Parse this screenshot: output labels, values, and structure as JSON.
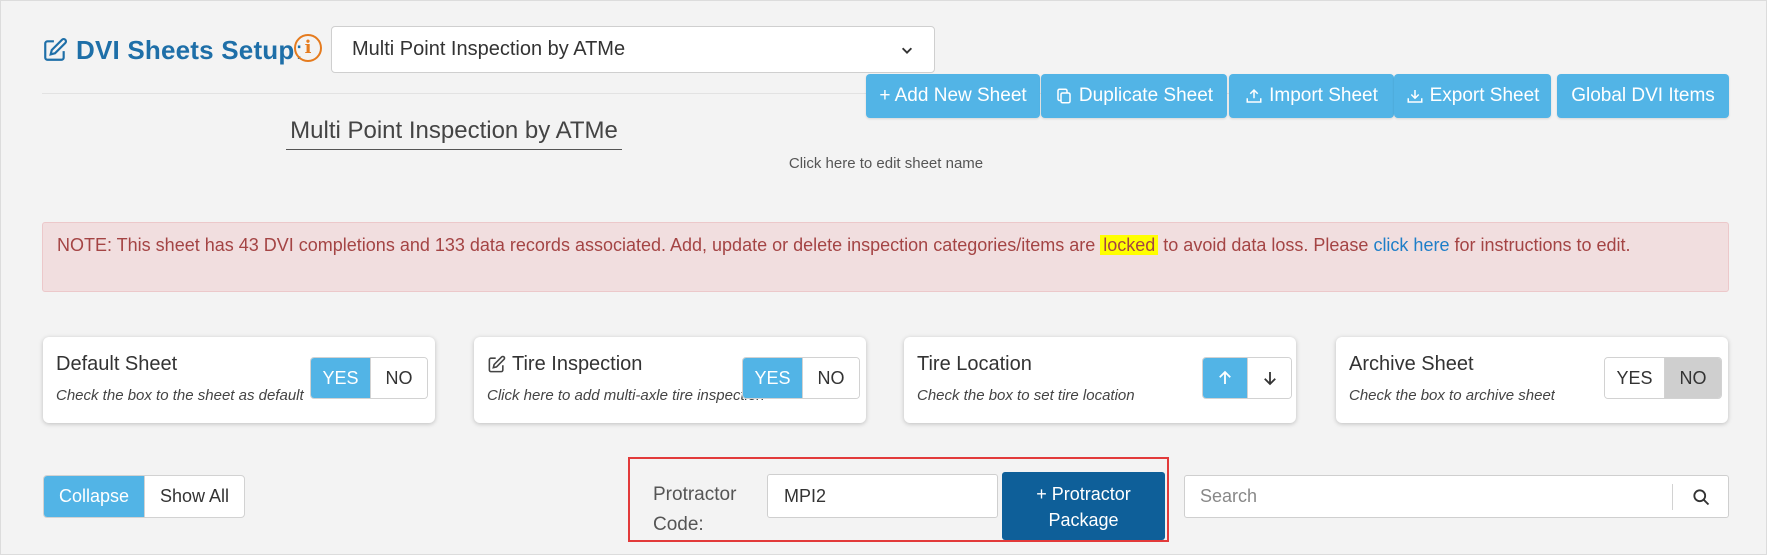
{
  "header": {
    "title": "DVI Sheets Setup",
    "colon": ":",
    "info_icon_glyph": "i",
    "selected_sheet": "Multi Point Inspection by ATMe"
  },
  "toolbar": {
    "add_new_sheet": "+ Add New Sheet",
    "duplicate_sheet": "Duplicate Sheet",
    "import_sheet": "Import Sheet",
    "export_sheet": "Export Sheet",
    "global_dvi_items": "Global DVI Items"
  },
  "sheet": {
    "name": "Multi Point Inspection by ATMe",
    "edit_hint": "Click here to edit sheet name"
  },
  "alert": {
    "text_before": "NOTE: This sheet has 43 DVI completions and 133 data records associated. Add, update or delete inspection categories/items are ",
    "highlight": "locked",
    "text_middle": " to avoid data loss. Please ",
    "link": "click here",
    "text_after": " for instructions to edit."
  },
  "cards": {
    "default_sheet": {
      "title": "Default Sheet",
      "subtitle": "Check the box to the sheet as default",
      "yes": "YES",
      "no": "NO",
      "selected": "YES"
    },
    "tire_inspection": {
      "title": "Tire Inspection",
      "subtitle": "Click here to add multi-axle tire inspection",
      "yes": "YES",
      "no": "NO",
      "selected": "YES"
    },
    "tire_location": {
      "title": "Tire Location",
      "subtitle": "Check the box to set tire location",
      "selected": "up"
    },
    "archive_sheet": {
      "title": "Archive Sheet",
      "subtitle": "Check the box to archive sheet",
      "yes": "YES",
      "no": "NO",
      "selected": "NO"
    }
  },
  "view": {
    "collapse": "Collapse",
    "show_all": "Show All"
  },
  "protractor": {
    "label_line1": "Protractor",
    "label_line2": "Code:",
    "value": "MPI2",
    "button_line1": "+ Protractor",
    "button_line2": "Package"
  },
  "search": {
    "placeholder": "Search"
  },
  "colors": {
    "accent": "#52b4e6",
    "title": "#1e6fa8",
    "dark_button": "#0e5f99",
    "alert_bg": "#f1dedf",
    "alert_text": "#a44444",
    "highlight": "#ffff00",
    "focus_outline": "#e23a3a"
  },
  "icons": {
    "title_icon": "edit-icon",
    "info_icon": "info-circle-icon",
    "duplicate_icon": "copy-icon",
    "import_icon": "upload-icon",
    "export_icon": "download-icon",
    "tire_inspection_icon": "edit-icon",
    "search_icon": "search-icon"
  }
}
